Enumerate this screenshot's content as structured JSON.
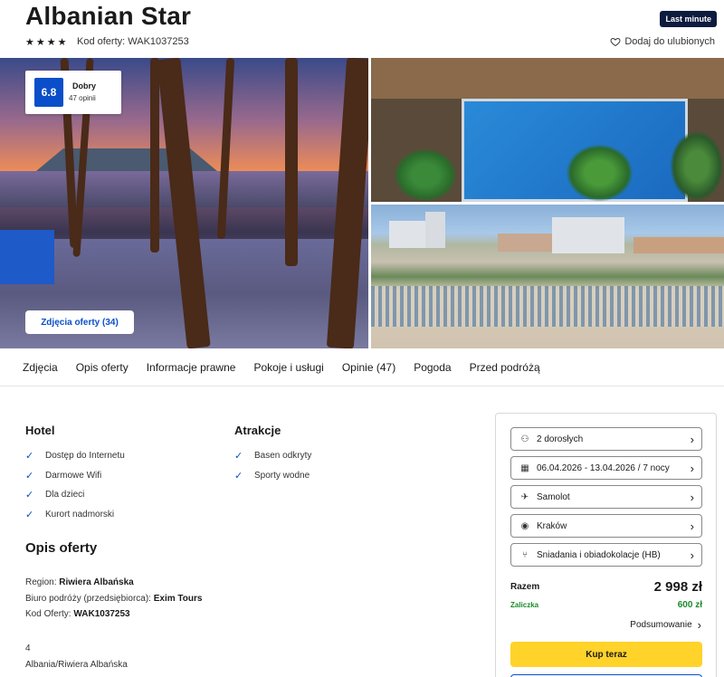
{
  "header": {
    "title": "Albanian Star",
    "badge": "Last minute",
    "stars": 4,
    "offer_code": "Kod oferty: WAK1037253",
    "favorite": "Dodaj do ulubionych"
  },
  "gallery": {
    "rating_score": "6.8",
    "rating_label": "Dobry",
    "rating_count": "47 opinii",
    "photos_button": "Zdjęcia oferty (34)"
  },
  "tabs": [
    "Zdjęcia",
    "Opis oferty",
    "Informacje prawne",
    "Pokoje i usługi",
    "Opinie (47)",
    "Pogoda",
    "Przed podróżą"
  ],
  "hotel": {
    "heading": "Hotel",
    "items": [
      "Dostęp do Internetu",
      "Darmowe Wifi",
      "Dla dzieci",
      "Kurort nadmorski"
    ]
  },
  "atrakcje": {
    "heading": "Atrakcje",
    "items": [
      "Basen odkryty",
      "Sporty wodne"
    ]
  },
  "opis": {
    "heading": "Opis oferty",
    "region_label": "Region: ",
    "region_value": "Riwiera Albańska",
    "biuro_label": "Biuro podróży (przedsiębiorca): ",
    "biuro_value": "Exim Tours",
    "kod_label": "Kod Oferty: ",
    "kod_value": "WAK1037253",
    "extra_1": "4",
    "extra_2": "Albania/Riwiera Albańska"
  },
  "booking": {
    "fields": [
      {
        "icon": "person-icon",
        "glyph": "⚇",
        "value": "2 dorosłych"
      },
      {
        "icon": "calendar-icon",
        "glyph": "▦",
        "value": "06.04.2026 - 13.04.2026 / 7 nocy"
      },
      {
        "icon": "plane-icon",
        "glyph": "✈",
        "value": "Samolot"
      },
      {
        "icon": "location-icon",
        "glyph": "◉",
        "value": "Kraków"
      },
      {
        "icon": "cutlery-icon",
        "glyph": "⑂",
        "value": "Śniadania i obiadokolacje (HB)"
      }
    ],
    "total_label": "Razem",
    "total_value": "2 998 zł",
    "deposit_label": "Zaliczka",
    "deposit_value": "600 zł",
    "summary_link": "Podsumowanie",
    "buy_button": "Kup teraz"
  },
  "colors": {
    "accent_blue": "#0a4fc9",
    "buy_yellow": "#ffd32a",
    "deposit_green": "#1a8a2a",
    "badge_navy": "#0d1b3e"
  }
}
